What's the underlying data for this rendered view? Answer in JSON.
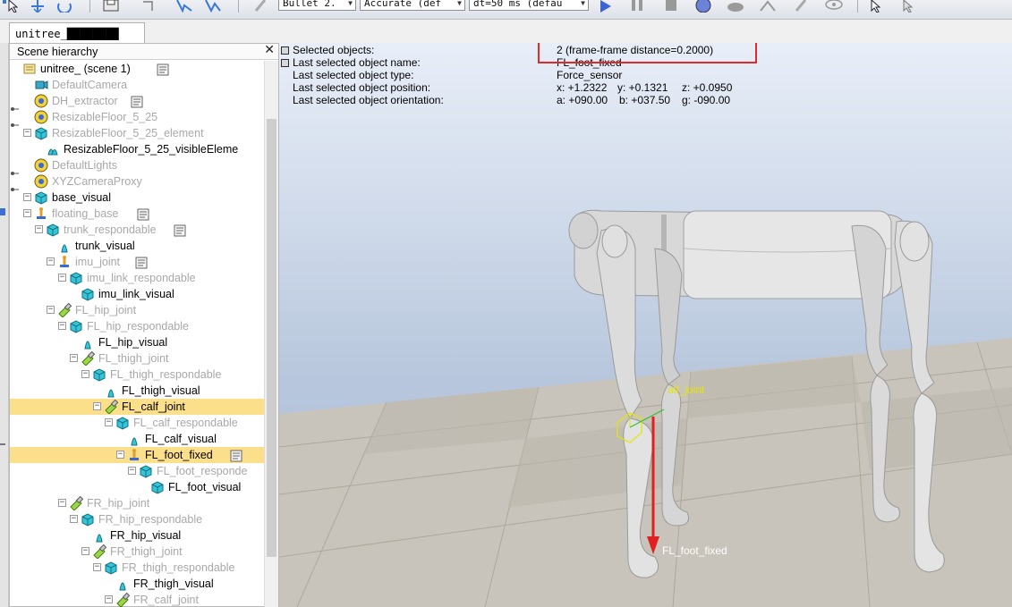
{
  "toolbar": {
    "physics_engine": "Bullet 2.",
    "engine_precision": "Accurate (def",
    "timestep": "dt=50 ms (defau",
    "icons": [
      "select-icon",
      "object-shift-icon",
      "object-rotate-icon",
      "save-icon",
      "undo-icon",
      "redo-icon",
      "assemble-icon",
      "play-icon",
      "pause-icon",
      "stop-icon",
      "realtime-icon",
      "turtle-icon",
      "rabbit-icon",
      "thread-icon",
      "visualization-icon",
      "cursor-icon",
      "cursor-plus-icon"
    ]
  },
  "scene_tab": {
    "label": "unitree_████████"
  },
  "hierarchy": {
    "title": "Scene hierarchy",
    "close": "✕",
    "rows": [
      {
        "label": "unitree_ (scene 1)",
        "icon": "scene-icon",
        "style": "act",
        "selected": false
      },
      {
        "label": "DefaultCamera",
        "icon": "camera-icon",
        "style": "dim",
        "selected": false
      },
      {
        "label": "DH_extractor",
        "icon": "dummy-icon",
        "style": "dim",
        "selected": false
      },
      {
        "label": "ResizableFloor_5_25",
        "icon": "dummy-icon",
        "style": "dim",
        "selected": false
      },
      {
        "label": "ResizableFloor_5_25_element",
        "icon": "cuboid-icon",
        "style": "dim",
        "selected": false
      },
      {
        "label": "ResizableFloor_5_25_visibleEleme",
        "icon": "shape-group-icon",
        "style": "act",
        "selected": false
      },
      {
        "label": "DefaultLights",
        "icon": "dummy-icon",
        "style": "dim",
        "selected": false
      },
      {
        "label": "XYZCameraProxy",
        "icon": "dummy-icon",
        "style": "dim",
        "selected": false
      },
      {
        "label": "base_visual",
        "icon": "cuboid-icon",
        "style": "act",
        "selected": false
      },
      {
        "label": "floating_base",
        "icon": "force-sensor-icon",
        "style": "dim",
        "selected": false
      },
      {
        "label": "trunk_respondable",
        "icon": "cuboid-icon",
        "style": "dim",
        "selected": false
      },
      {
        "label": "trunk_visual",
        "icon": "mesh-icon",
        "style": "act",
        "selected": false
      },
      {
        "label": "imu_joint",
        "icon": "force-sensor-icon",
        "style": "dim",
        "selected": false
      },
      {
        "label": "imu_link_respondable",
        "icon": "cuboid-icon",
        "style": "dim",
        "selected": false
      },
      {
        "label": "imu_link_visual",
        "icon": "cuboid-icon",
        "style": "act",
        "selected": false
      },
      {
        "label": "FL_hip_joint",
        "icon": "joint-icon",
        "style": "dim",
        "selected": false
      },
      {
        "label": "FL_hip_respondable",
        "icon": "cuboid-icon",
        "style": "dim",
        "selected": false
      },
      {
        "label": "FL_hip_visual",
        "icon": "mesh-icon",
        "style": "act",
        "selected": false
      },
      {
        "label": "FL_thigh_joint",
        "icon": "joint-icon",
        "style": "dim",
        "selected": false
      },
      {
        "label": "FL_thigh_respondable",
        "icon": "cuboid-icon",
        "style": "dim",
        "selected": false
      },
      {
        "label": "FL_thigh_visual",
        "icon": "mesh-icon",
        "style": "act",
        "selected": false
      },
      {
        "label": "FL_calf_joint",
        "icon": "joint-icon",
        "style": "act",
        "selected": true
      },
      {
        "label": "FL_calf_respondable",
        "icon": "cuboid-icon",
        "style": "dim",
        "selected": false
      },
      {
        "label": "FL_calf_visual",
        "icon": "mesh-icon",
        "style": "act",
        "selected": false
      },
      {
        "label": "FL_foot_fixed",
        "icon": "force-sensor-icon",
        "style": "act",
        "selected": true
      },
      {
        "label": "FL_foot_responde",
        "icon": "cuboid-icon",
        "style": "dim",
        "selected": false
      },
      {
        "label": "FL_foot_visual",
        "icon": "cuboid-icon",
        "style": "act",
        "selected": false
      },
      {
        "label": "FR_hip_joint",
        "icon": "joint-icon",
        "style": "dim",
        "selected": false
      },
      {
        "label": "FR_hip_respondable",
        "icon": "cuboid-icon",
        "style": "dim",
        "selected": false
      },
      {
        "label": "FR_hip_visual",
        "icon": "mesh-icon",
        "style": "act",
        "selected": false
      },
      {
        "label": "FR_thigh_joint",
        "icon": "joint-icon",
        "style": "dim",
        "selected": false
      },
      {
        "label": "FR_thigh_respondable",
        "icon": "cuboid-icon",
        "style": "dim",
        "selected": false
      },
      {
        "label": "FR_thigh_visual",
        "icon": "mesh-icon",
        "style": "act",
        "selected": false
      },
      {
        "label": "FR_calf_joint",
        "icon": "joint-icon",
        "style": "dim",
        "selected": false
      }
    ]
  },
  "info": {
    "selected_objects_key": "Selected objects:",
    "selected_objects_val": "2 (frame-frame distance=0.2000)",
    "last_name_key": "Last selected object name:",
    "last_name_val": "FL_foot_fixed",
    "last_type_key": "Last selected object type:",
    "last_type_val": "Force_sensor",
    "last_pos_key": "Last selected object position:",
    "pos_x": "x: +1.2322",
    "pos_y": "y: +0.1321",
    "pos_z": "z: +0.0950",
    "last_orient_key": "Last selected object orientation:",
    "orient_a": "a: +090.00",
    "orient_b": "b: +037.50",
    "orient_g": "g: -090.00"
  },
  "viewport": {
    "calf_joint_label": "alf_joint",
    "foot_label": "FL_foot_fixed",
    "highlight_color": "#e02a2a",
    "selection_color": "#fcdf8a"
  }
}
